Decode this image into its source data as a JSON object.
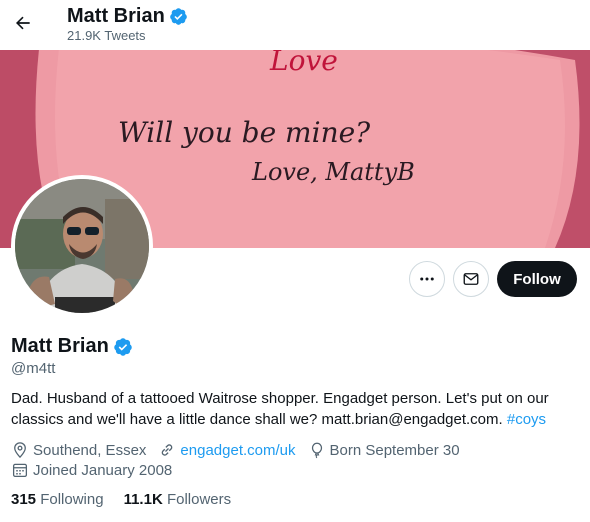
{
  "header": {
    "title": "Matt Brian",
    "tweet_count": "21.9K Tweets"
  },
  "banner": {
    "line1": "Will you be mine?",
    "line2": "Love, MattyB",
    "bg_color": "#cb5a72"
  },
  "profile": {
    "name": "Matt Brian",
    "handle": "@m4tt",
    "bio_text": "Dad. Husband of a tattooed Waitrose shopper. Engadget person. Let's put on our classics and we'll have a little dance shall we? matt.brian@engadget.com.",
    "bio_hashtag": "#coys",
    "location": "Southend, Essex",
    "website": "engadget.com/uk",
    "birthday": "Born September 30",
    "joined": "Joined January 2008",
    "following_count": "315",
    "following_label": "Following",
    "followers_count": "11.1K",
    "followers_label": "Followers"
  },
  "actions": {
    "follow_label": "Follow",
    "more_icon": "more-icon",
    "message_icon": "envelope-icon"
  },
  "colors": {
    "accent": "#1d9bf0",
    "text": "#0f1419",
    "secondary": "#536471"
  }
}
